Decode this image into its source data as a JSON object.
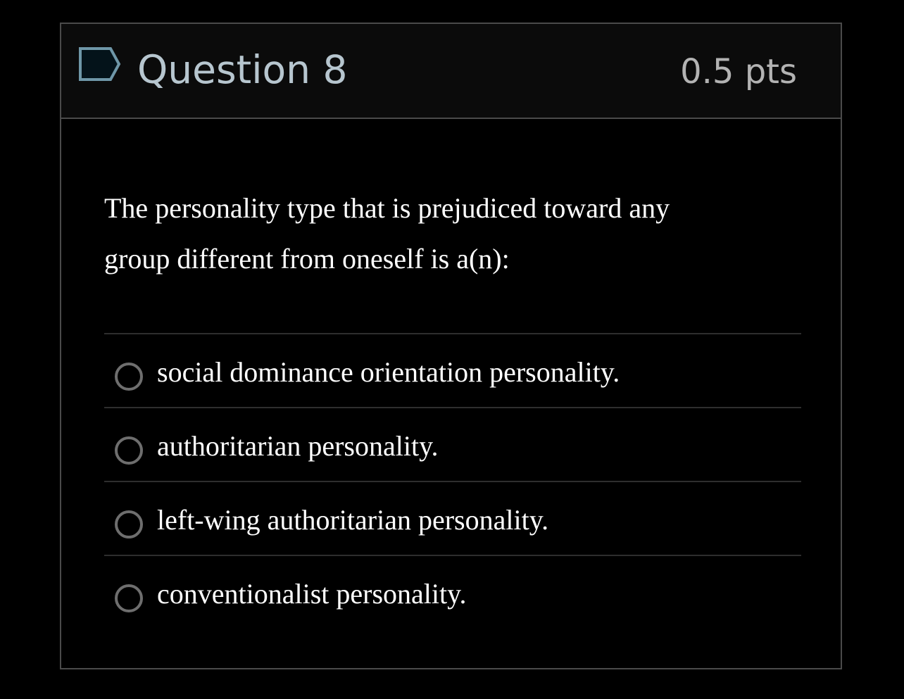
{
  "question": {
    "title": "Question 8",
    "points": "0.5 pts",
    "flag_icon": "flag-icon",
    "text_line1": "The personality type that is prejudiced toward any",
    "text_line2": "group different from oneself is a(n):"
  },
  "answers": [
    {
      "label": "social dominance orientation personality.",
      "selected": false
    },
    {
      "label": "authoritarian personality.",
      "selected": false
    },
    {
      "label": "left-wing authoritarian personality.",
      "selected": false
    },
    {
      "label": "conventionalist personality.",
      "selected": false
    }
  ],
  "colors": {
    "background": "#000000",
    "header_bg": "#0b0b0b",
    "border": "#4a4a4a",
    "title": "#b7c6cf",
    "flag_fill": "#1d3a4a",
    "flag_stroke": "#7fa7b8",
    "text": "#ffffff",
    "radio": "#6e6e6e"
  }
}
